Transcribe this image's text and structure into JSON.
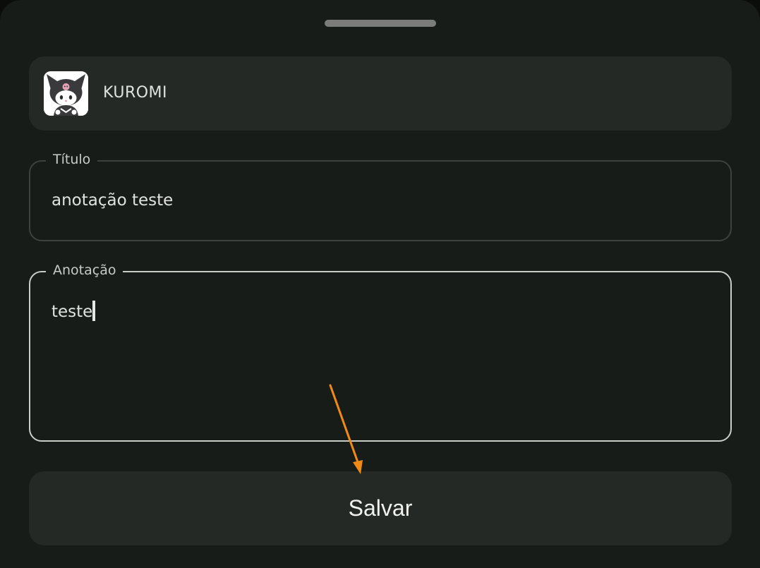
{
  "profile": {
    "name": "KUROMI",
    "avatar_icon": "kuromi-avatar-icon"
  },
  "title_field": {
    "label": "Título",
    "value": "anotação teste"
  },
  "note_field": {
    "label": "Anotação",
    "value": "teste"
  },
  "save_button": {
    "label": "Salvar"
  },
  "colors": {
    "sheet_background": "#181c19",
    "card_background": "#252925",
    "focused_border": "#c9cdc8",
    "arrow": "#f08a14"
  }
}
